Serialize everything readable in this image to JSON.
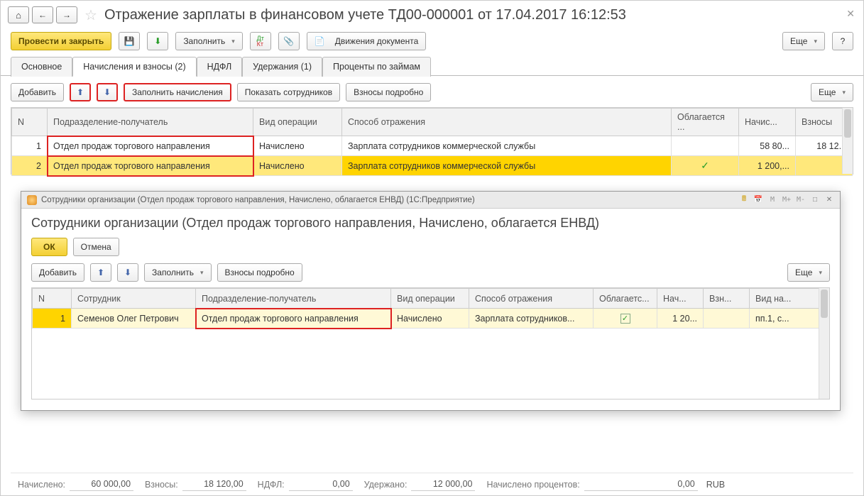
{
  "title": "Отражение зарплаты в финансовом учете ТД00-000001 от 17.04.2017 16:12:53",
  "cmd": {
    "post_close": "Провести и закрыть",
    "fill": "Заполнить",
    "movements": "Движения документа",
    "more": "Еще"
  },
  "tabs": [
    "Основное",
    "Начисления и взносы (2)",
    "НДФЛ",
    "Удержания (1)",
    "Проценты по займам"
  ],
  "tbar2": {
    "add": "Добавить",
    "fill_acc": "Заполнить начисления",
    "show_emp": "Показать сотрудников",
    "fees_detail": "Взносы подробно",
    "more": "Еще"
  },
  "grid1": {
    "cols": [
      "N",
      "Подразделение-получатель",
      "Вид операции",
      "Способ отражения",
      "Облагается ...",
      "Начис...",
      "Взносы"
    ],
    "rows": [
      {
        "n": "1",
        "dep": "Отдел продаж торгового направления",
        "op": "Начислено",
        "way": "Зарплата сотрудников коммерческой службы",
        "tax": "",
        "acc": "58 80...",
        "fee": "18 12..."
      },
      {
        "n": "2",
        "dep": "Отдел продаж торгового направления",
        "op": "Начислено",
        "way": "Зарплата сотрудников коммерческой службы",
        "tax": "✓",
        "acc": "1 200,...",
        "fee": ""
      }
    ]
  },
  "dialog": {
    "hdr": "Сотрудники организации (Отдел продаж торгового направления, Начислено, облагается ЕНВД)   (1С:Предприятие)",
    "title": "Сотрудники организации (Отдел продаж торгового направления, Начислено, облагается ЕНВД)",
    "ok": "ОК",
    "cancel": "Отмена",
    "add": "Добавить",
    "fill": "Заполнить",
    "fees": "Взносы подробно",
    "more": "Еще",
    "cols": [
      "N",
      "Сотрудник",
      "Подразделение-получатель",
      "Вид операции",
      "Способ отражения",
      "Облагаетс...",
      "Нач...",
      "Взн...",
      "Вид на..."
    ],
    "row": {
      "n": "1",
      "emp": "Семенов Олег Петрович",
      "dep": "Отдел продаж торгового направления",
      "op": "Начислено",
      "way": "Зарплата сотрудников...",
      "acc": "1 20...",
      "fee": "",
      "vid": "пп.1, с..."
    }
  },
  "footer": {
    "l1": "Начислено:",
    "v1": "60 000,00",
    "l2": "Взносы:",
    "v2": "18 120,00",
    "l3": "НДФЛ:",
    "v3": "0,00",
    "l4": "Удержано:",
    "v4": "12 000,00",
    "l5": "Начислено процентов:",
    "v5": "0,00",
    "cur": "RUB"
  },
  "mbtns": [
    "M",
    "M+",
    "M-"
  ]
}
